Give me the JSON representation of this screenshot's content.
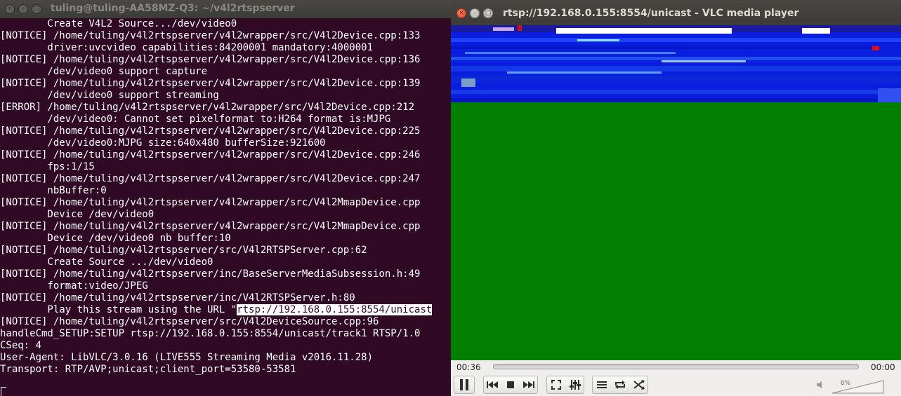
{
  "terminal": {
    "title": "tuling@tuling-AA58MZ-Q3: ~/v4l2rtspserver",
    "lines": [
      "        Create V4L2 Source.../dev/video0",
      "[NOTICE] /home/tuling/v4l2rtspserver/v4l2wrapper/src/V4l2Device.cpp:133",
      "        driver:uvcvideo capabilities:84200001 mandatory:4000001",
      "[NOTICE] /home/tuling/v4l2rtspserver/v4l2wrapper/src/V4l2Device.cpp:136",
      "        /dev/video0 support capture",
      "[NOTICE] /home/tuling/v4l2rtspserver/v4l2wrapper/src/V4l2Device.cpp:139",
      "        /dev/video0 support streaming",
      "[ERROR] /home/tuling/v4l2rtspserver/v4l2wrapper/src/V4l2Device.cpp:212",
      "        /dev/video0: Cannot set pixelformat to:H264 format is:MJPG",
      "[NOTICE] /home/tuling/v4l2rtspserver/v4l2wrapper/src/V4l2Device.cpp:225",
      "        /dev/video0:MJPG size:640x480 bufferSize:921600",
      "[NOTICE] /home/tuling/v4l2rtspserver/v4l2wrapper/src/V4l2Device.cpp:246",
      "        fps:1/15",
      "[NOTICE] /home/tuling/v4l2rtspserver/v4l2wrapper/src/V4l2Device.cpp:247",
      "        nbBuffer:0",
      "[NOTICE] /home/tuling/v4l2rtspserver/v4l2wrapper/src/V4l2MmapDevice.cpp",
      "        Device /dev/video0",
      "[NOTICE] /home/tuling/v4l2rtspserver/v4l2wrapper/src/V4l2MmapDevice.cpp",
      "        Device /dev/video0 nb buffer:10",
      "[NOTICE] /home/tuling/v4l2rtspserver/src/V4l2RTSPServer.cpp:62",
      "        Create Source .../dev/video0",
      "[NOTICE] /home/tuling/v4l2rtspserver/inc/BaseServerMediaSubsession.h:49",
      "        format:video/JPEG",
      "[NOTICE] /home/tuling/v4l2rtspserver/inc/V4l2RTSPServer.h:80"
    ],
    "play_prefix": "        Play this stream using the URL \"",
    "play_url": "rtsp://192.168.0.155:8554/unicast",
    "lines_after": [
      "[NOTICE] /home/tuling/v4l2rtspserver/src/V4l2DeviceSource.cpp:96",
      "handleCmd_SETUP:SETUP rtsp://192.168.0.155:8554/unicast/track1 RTSP/1.0",
      "CSeq: 4",
      "User-Agent: LibVLC/3.0.16 (LIVE555 Streaming Media v2016.11.28)",
      "Transport: RTP/AVP;unicast;client_port=53580-53581"
    ]
  },
  "vlc": {
    "title": "rtsp://192.168.0.155:8554/unicast - VLC media player",
    "elapsed": "00:36",
    "remaining": "00:00",
    "playback_progress": 0,
    "volume": "0%",
    "video_color": "#007f00"
  },
  "colors": {
    "terminal_bg": "#300a24",
    "close_button": "#e0461d"
  }
}
